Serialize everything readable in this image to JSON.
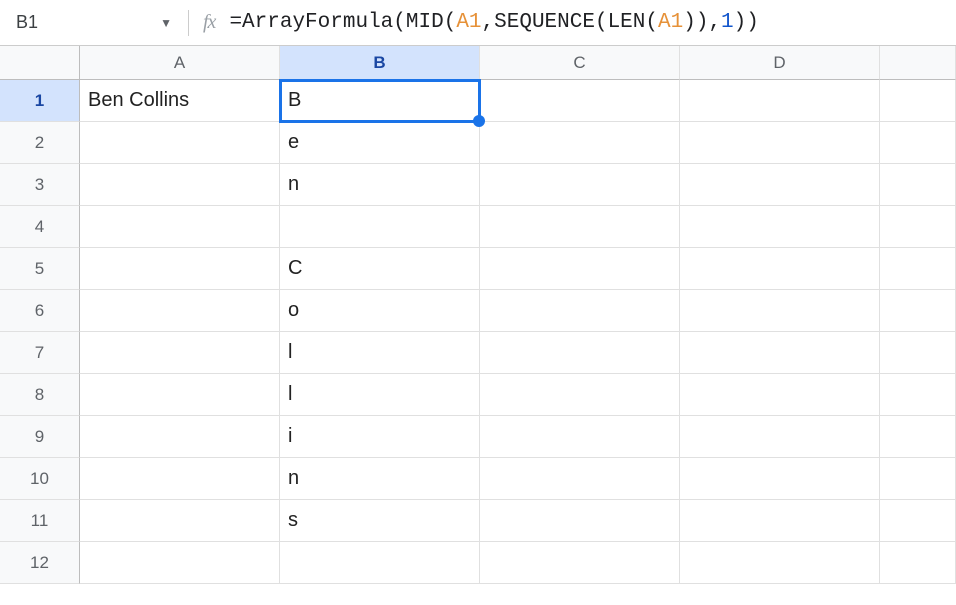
{
  "formula_bar": {
    "name_box": "B1",
    "fx_label": "fx",
    "formula_tokens": [
      {
        "t": "=",
        "cls": "tok-punc"
      },
      {
        "t": "ArrayFormula",
        "cls": "tok-fn"
      },
      {
        "t": "(",
        "cls": "tok-punc"
      },
      {
        "t": "MID",
        "cls": "tok-fn"
      },
      {
        "t": "(",
        "cls": "tok-punc"
      },
      {
        "t": "A1",
        "cls": "tok-ref"
      },
      {
        "t": ",",
        "cls": "tok-punc"
      },
      {
        "t": "SEQUENCE",
        "cls": "tok-fn"
      },
      {
        "t": "(",
        "cls": "tok-punc"
      },
      {
        "t": "LEN",
        "cls": "tok-fn"
      },
      {
        "t": "(",
        "cls": "tok-punc"
      },
      {
        "t": "A1",
        "cls": "tok-ref"
      },
      {
        "t": ")",
        "cls": "tok-punc"
      },
      {
        "t": ")",
        "cls": "tok-punc"
      },
      {
        "t": ",",
        "cls": "tok-punc"
      },
      {
        "t": "1",
        "cls": "tok-num"
      },
      {
        "t": ")",
        "cls": "tok-punc"
      },
      {
        "t": ")",
        "cls": "tok-punc"
      }
    ]
  },
  "sheet": {
    "columns": [
      "A",
      "B",
      "C",
      "D",
      ""
    ],
    "selected_col": "B",
    "selected_row": 1,
    "selected_cell": "B1",
    "rows": [
      {
        "n": 1,
        "A": "Ben Collins",
        "B": "B",
        "C": "",
        "D": "",
        "E": ""
      },
      {
        "n": 2,
        "A": "",
        "B": "e",
        "C": "",
        "D": "",
        "E": ""
      },
      {
        "n": 3,
        "A": "",
        "B": "n",
        "C": "",
        "D": "",
        "E": ""
      },
      {
        "n": 4,
        "A": "",
        "B": "",
        "C": "",
        "D": "",
        "E": ""
      },
      {
        "n": 5,
        "A": "",
        "B": "C",
        "C": "",
        "D": "",
        "E": ""
      },
      {
        "n": 6,
        "A": "",
        "B": "o",
        "C": "",
        "D": "",
        "E": ""
      },
      {
        "n": 7,
        "A": "",
        "B": "l",
        "C": "",
        "D": "",
        "E": ""
      },
      {
        "n": 8,
        "A": "",
        "B": "l",
        "C": "",
        "D": "",
        "E": ""
      },
      {
        "n": 9,
        "A": "",
        "B": "i",
        "C": "",
        "D": "",
        "E": ""
      },
      {
        "n": 10,
        "A": "",
        "B": "n",
        "C": "",
        "D": "",
        "E": ""
      },
      {
        "n": 11,
        "A": "",
        "B": "s",
        "C": "",
        "D": "",
        "E": ""
      },
      {
        "n": 12,
        "A": "",
        "B": "",
        "C": "",
        "D": "",
        "E": ""
      }
    ]
  }
}
